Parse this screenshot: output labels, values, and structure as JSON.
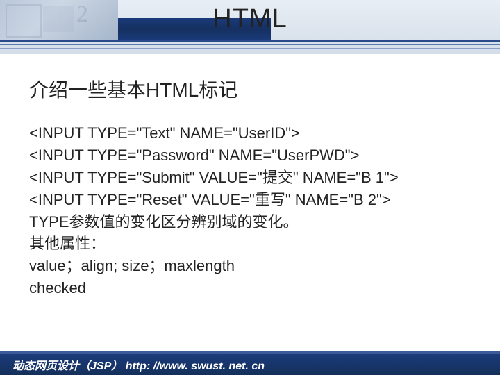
{
  "header": {
    "title": "HTML"
  },
  "subtitle": "介绍一些基本HTML标记",
  "codeLines": [
    "<INPUT TYPE=\"Text\" NAME=\"UserID\">",
    "<INPUT TYPE=\"Password\" NAME=\"UserPWD\">",
    "<INPUT TYPE=\"Submit\" VALUE=\"提交\" NAME=\"B 1\">",
    "<INPUT TYPE=\"Reset\" VALUE=\"重写\" NAME=\"B 2\">"
  ],
  "notes": [
    "TYPE参数值的变化区分辨别域的变化。",
    "其他属性：",
    " value；align; size；maxlength",
    "checked"
  ],
  "footer": "动态网页设计（JSP） http: //www. swust. net. cn"
}
